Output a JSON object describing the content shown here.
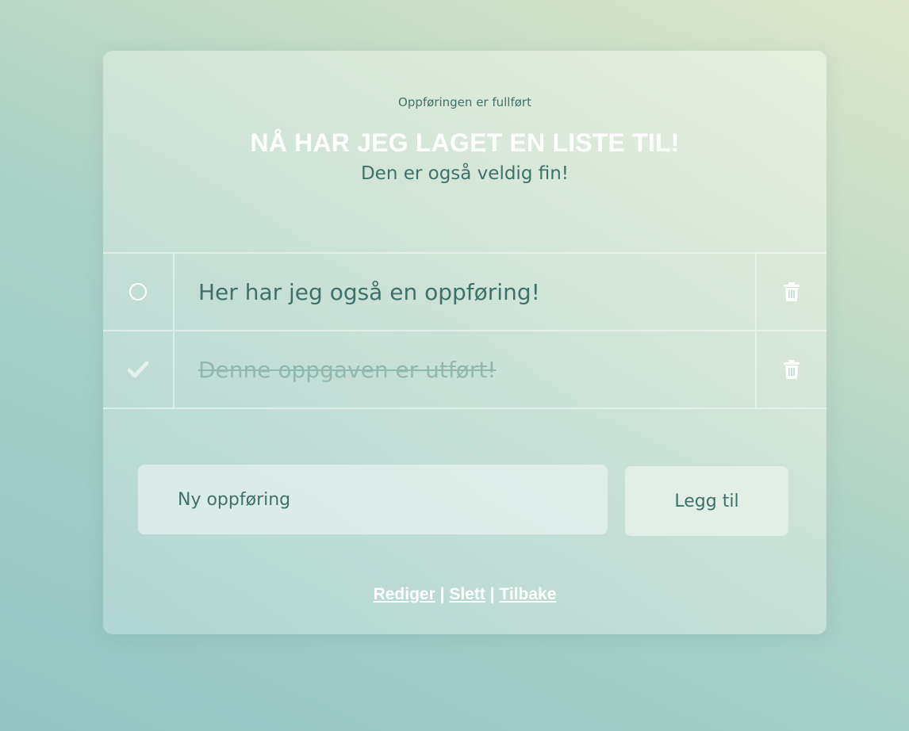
{
  "status_message": "Oppføringen er fullført",
  "list": {
    "title": "NÅ HAR JEG LAGET EN LISTE TIL!",
    "subtitle": "Den er også veldig fin!"
  },
  "tasks": [
    {
      "text": "Her har jeg også en oppføring!",
      "done": false,
      "status_icon": "circle-icon",
      "delete_icon": "trash-icon"
    },
    {
      "text": "Denne oppgaven er utført!",
      "done": true,
      "status_icon": "checkmark-icon",
      "delete_icon": "trash-icon"
    }
  ],
  "new_entry": {
    "placeholder": "Ny oppføring",
    "value": ""
  },
  "add_button_label": "Legg til",
  "footer": {
    "edit_label": "Rediger",
    "delete_label": "Slett",
    "back_label": "Tilbake",
    "separator": "|"
  },
  "colors": {
    "text_primary": "#3d726b",
    "text_done": "#8fb9ae",
    "heading": "#ffffff",
    "background_start": "#dde6cb",
    "background_end": "#93c6c4"
  }
}
